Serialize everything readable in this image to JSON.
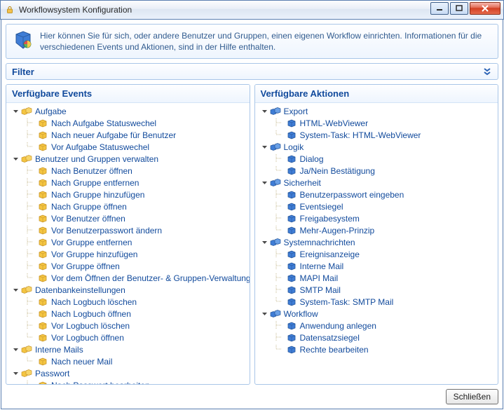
{
  "window": {
    "title": "Workflowsystem Konfiguration"
  },
  "info": {
    "text": "Hier können Sie für sich, oder andere Benutzer und Gruppen, einen eigenen Workflow einrichten. Informationen für die verschiedenen Events und Aktionen, sind in der Hilfe enthalten."
  },
  "filter": {
    "label": "Filter"
  },
  "events": {
    "header": "Verfügbare Events",
    "groups": [
      {
        "label": "Aufgabe",
        "items": [
          "Nach Aufgabe Statuswechel",
          "Nach neuer Aufgabe für Benutzer",
          "Vor Aufgabe Statuswechel"
        ]
      },
      {
        "label": "Benutzer und Gruppen verwalten",
        "items": [
          "Nach Benutzer öffnen",
          "Nach Gruppe entfernen",
          "Nach Gruppe hinzufügen",
          "Nach Gruppe öffnen",
          "Vor Benutzer öffnen",
          "Vor Benutzerpasswort ändern",
          "Vor Gruppe entfernen",
          "Vor Gruppe hinzufügen",
          "Vor Gruppe öffnen",
          "Vor dem Öffnen der Benutzer- & Gruppen-Verwaltung"
        ]
      },
      {
        "label": "Datenbankeinstellungen",
        "items": [
          "Nach Logbuch löschen",
          "Nach Logbuch öffnen",
          "Vor Logbuch löschen",
          "Vor Logbuch öffnen"
        ]
      },
      {
        "label": "Interne Mails",
        "items": [
          "Nach neuer Mail"
        ]
      },
      {
        "label": "Passwort",
        "items": [
          "Nach Passwort bearbeiten"
        ]
      }
    ]
  },
  "actions": {
    "header": "Verfügbare Aktionen",
    "groups": [
      {
        "label": "Export",
        "items": [
          "HTML-WebViewer",
          "System-Task: HTML-WebViewer"
        ]
      },
      {
        "label": "Logik",
        "items": [
          "Dialog",
          "Ja/Nein Bestätigung"
        ]
      },
      {
        "label": "Sicherheit",
        "items": [
          "Benutzerpasswort eingeben",
          "Eventsiegel",
          "Freigabesystem",
          "Mehr-Augen-Prinzip"
        ]
      },
      {
        "label": "Systemnachrichten",
        "items": [
          "Ereignisanzeige",
          "Interne Mail",
          "MAPI Mail",
          "SMTP Mail",
          "System-Task: SMTP Mail"
        ]
      },
      {
        "label": "Workflow",
        "items": [
          "Anwendung anlegen",
          "Datensatzsiegel",
          "Rechte bearbeiten"
        ]
      }
    ]
  },
  "footer": {
    "close": "Schließen"
  },
  "colors": {
    "accent": "#114a9c",
    "border": "#a9c6e8"
  }
}
